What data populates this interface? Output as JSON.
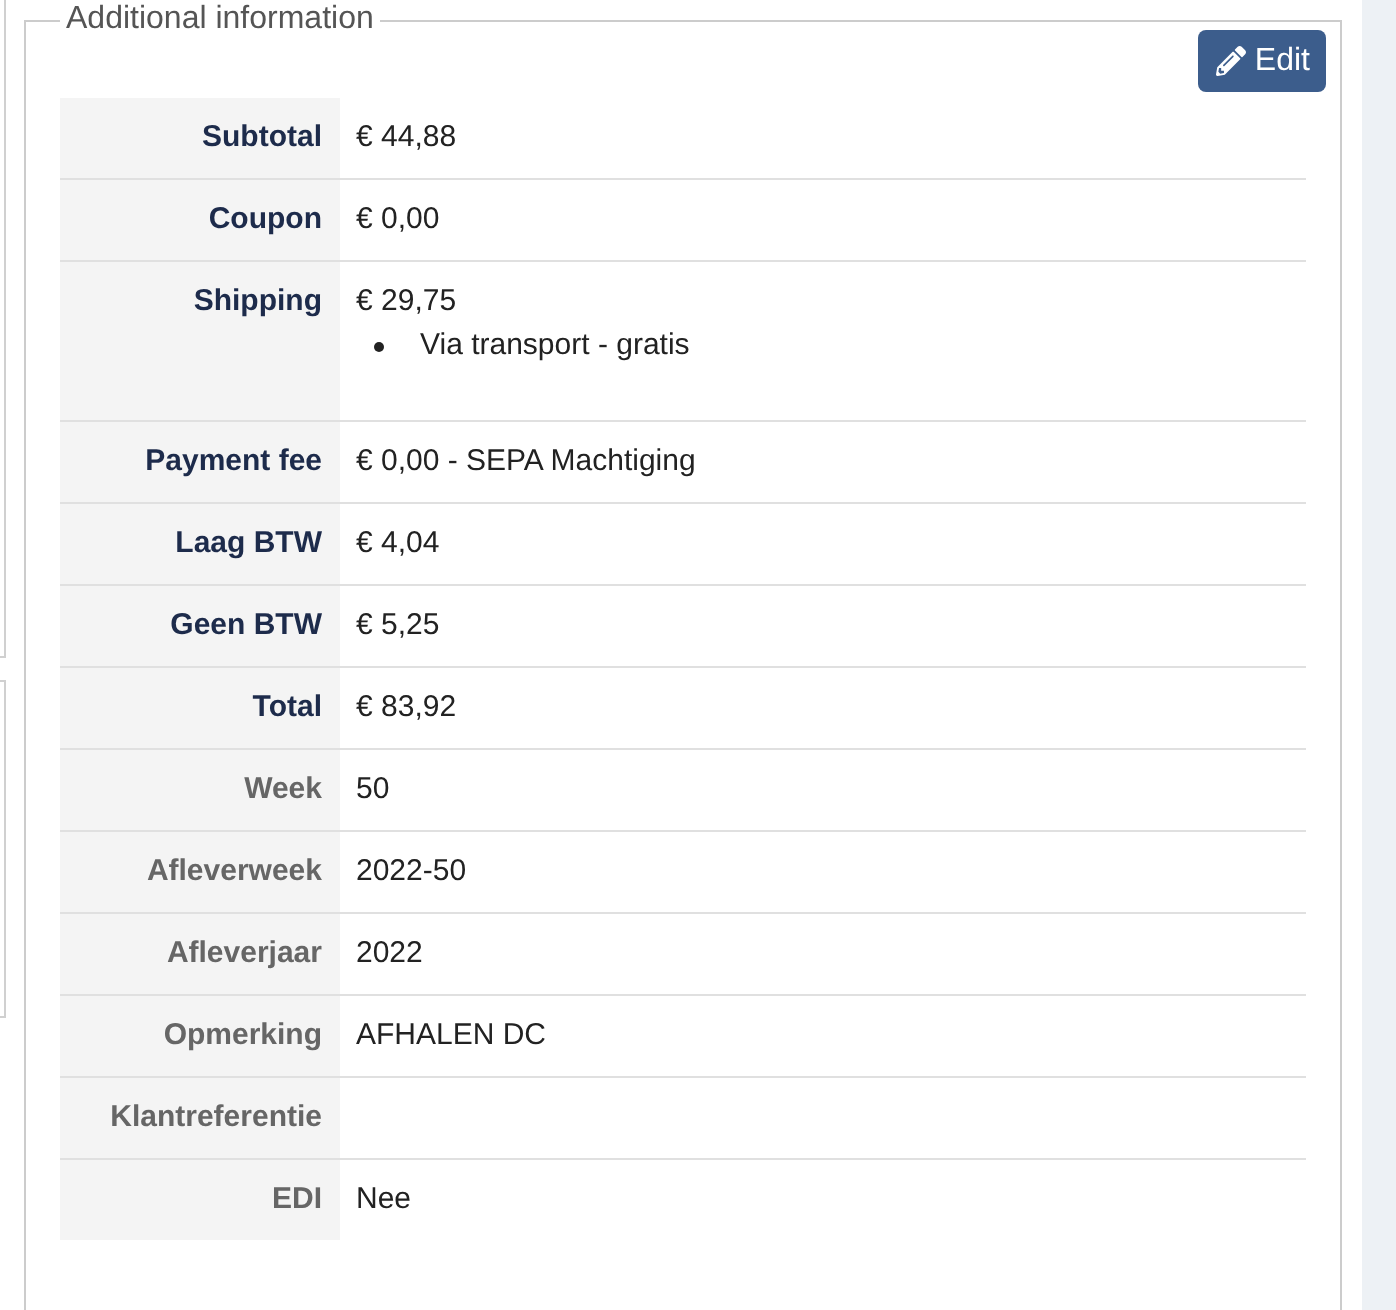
{
  "panel": {
    "title": "Additional information",
    "edit_button": {
      "label": "Edit"
    }
  },
  "rows": [
    {
      "kind": "total",
      "label": "Subtotal",
      "value": "€ 44,88"
    },
    {
      "kind": "total",
      "label": "Coupon",
      "value": "€ 0,00"
    },
    {
      "kind": "total",
      "label": "Shipping",
      "value": "€ 29,75",
      "details": [
        "Via transport - gratis"
      ]
    },
    {
      "kind": "total",
      "label": "Payment fee",
      "value": "€ 0,00 - SEPA Machtiging"
    },
    {
      "kind": "total",
      "label": "Laag BTW",
      "value": "€ 4,04"
    },
    {
      "kind": "total",
      "label": "Geen BTW",
      "value": "€ 5,25"
    },
    {
      "kind": "total",
      "label": "Total",
      "value": "€ 83,92"
    },
    {
      "kind": "field",
      "label": "Week",
      "value": "50"
    },
    {
      "kind": "field",
      "label": "Afleverweek",
      "value": "2022-50"
    },
    {
      "kind": "field",
      "label": "Afleverjaar",
      "value": "2022"
    },
    {
      "kind": "field",
      "label": "Opmerking",
      "value": "AFHALEN DC"
    },
    {
      "kind": "field",
      "label": "Klantreferentie"
    },
    {
      "kind": "field",
      "label": "EDI",
      "value": "Nee"
    }
  ]
}
